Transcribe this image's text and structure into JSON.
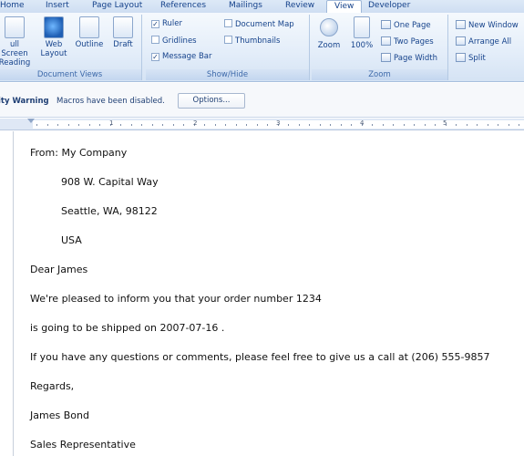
{
  "tabs": [
    "Home",
    "Insert",
    "Page Layout",
    "References",
    "Mailings",
    "Review",
    "View",
    "Developer"
  ],
  "active_tab": "View",
  "ribbon": {
    "document_views": {
      "label": "Document Views",
      "buttons": [
        {
          "line1": "ull Screen",
          "line2": "Reading"
        },
        {
          "line1": "Web",
          "line2": "Layout"
        },
        {
          "line1": "Outline",
          "line2": ""
        },
        {
          "line1": "Draft",
          "line2": ""
        }
      ]
    },
    "show_hide": {
      "label": "Show/Hide",
      "options": [
        {
          "label": "Ruler",
          "checked": true
        },
        {
          "label": "Gridlines",
          "checked": false
        },
        {
          "label": "Message Bar",
          "checked": true
        },
        {
          "label": "Document Map",
          "checked": false
        },
        {
          "label": "Thumbnails",
          "checked": false
        }
      ]
    },
    "zoom": {
      "label": "Zoom",
      "zoom_label": "Zoom",
      "hundred_label": "100%",
      "one_page": "One Page",
      "two_pages": "Two Pages",
      "page_width": "Page Width"
    },
    "window": {
      "new_window": "New Window",
      "arrange_all": "Arrange All",
      "split": "Split"
    }
  },
  "message_bar": {
    "title": "ity Warning",
    "text": "Macros have been disabled.",
    "button": "Options..."
  },
  "ruler": {
    "numbers": [
      "1",
      "2",
      "3",
      "4",
      "5"
    ]
  },
  "document": {
    "lines": [
      "From: My Company",
      "908 W. Capital Way",
      "Seattle, WA, 98122",
      "USA",
      "Dear James",
      "We're pleased to inform you that your order number 1234",
      "is going to be shipped on 2007-07-16 .",
      "If you have any questions or comments, please feel free to give us a call at (206) 555-9857",
      "Regards,",
      "James Bond",
      "Sales Representative"
    ]
  }
}
